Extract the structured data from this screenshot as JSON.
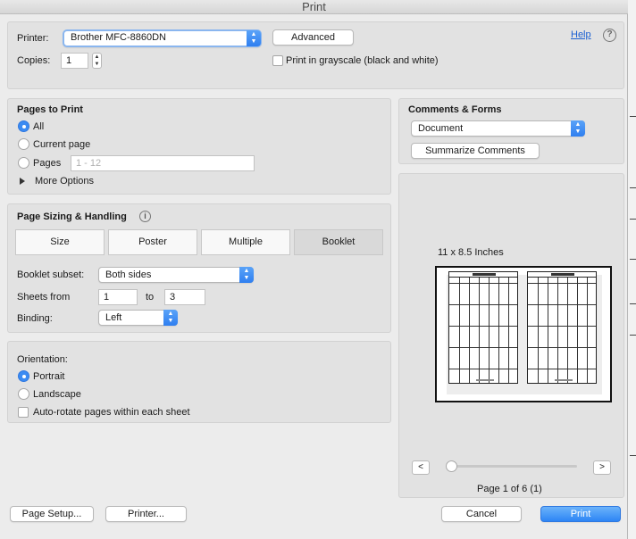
{
  "window": {
    "title": "Print"
  },
  "printer": {
    "label": "Printer:",
    "selected": "Brother MFC-8860DN",
    "advanced_button": "Advanced",
    "help_link": "Help",
    "copies_label": "Copies:",
    "copies_value": "1",
    "grayscale_label": "Print in grayscale (black and white)"
  },
  "pages_to_print": {
    "title": "Pages to Print",
    "all_label": "All",
    "current_label": "Current page",
    "pages_label": "Pages",
    "pages_placeholder": "1 - 12",
    "more_options": "More Options",
    "selected": "All"
  },
  "comments_forms": {
    "title": "Comments & Forms",
    "selected": "Document",
    "summarize_button": "Summarize Comments"
  },
  "sizing": {
    "title": "Page Sizing & Handling",
    "tabs": [
      "Size",
      "Poster",
      "Multiple",
      "Booklet"
    ],
    "selected_tab": "Booklet",
    "booklet_subset_label": "Booklet subset:",
    "booklet_subset_value": "Both sides",
    "sheets_from_label": "Sheets from",
    "sheets_from_value": "1",
    "to_label": "to",
    "sheets_to_value": "3",
    "binding_label": "Binding:",
    "binding_value": "Left"
  },
  "orientation": {
    "title": "Orientation:",
    "portrait_label": "Portrait",
    "landscape_label": "Landscape",
    "autorotate_label": "Auto-rotate pages within each sheet",
    "selected": "Portrait"
  },
  "preview": {
    "paper_size": "11 x 8.5 Inches",
    "page_status": "Page 1 of 6 (1)",
    "prev_glyph": "<",
    "next_glyph": ">",
    "slider_position": 0
  },
  "footer": {
    "page_setup_button": "Page Setup...",
    "printer_button": "Printer...",
    "cancel_button": "Cancel",
    "print_button": "Print"
  },
  "colors": {
    "accent": "#2d85f5",
    "dialog_bg": "#ececec",
    "panel_bg": "#e2e2e2"
  }
}
